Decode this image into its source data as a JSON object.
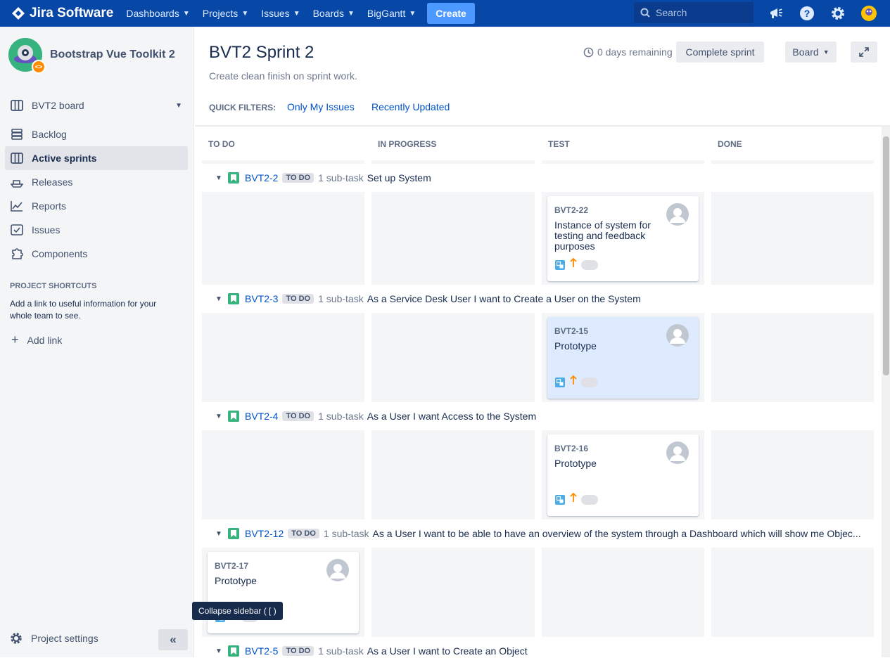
{
  "nav": {
    "logo": "Jira Software",
    "items": [
      "Dashboards",
      "Projects",
      "Issues",
      "Boards",
      "BigGantt"
    ],
    "create": "Create",
    "search_placeholder": "Search"
  },
  "sidebar": {
    "project_name": "Bootstrap Vue Toolkit 2",
    "board": "BVT2 board",
    "items": [
      "Backlog",
      "Active sprints",
      "Releases",
      "Reports",
      "Issues",
      "Components"
    ],
    "shortcuts_heading": "PROJECT SHORTCUTS",
    "shortcuts_text": "Add a link to useful information for your whole team to see.",
    "add_link": "Add link",
    "project_settings": "Project settings",
    "collapse_tooltip": "Collapse sidebar ( [ )"
  },
  "header": {
    "title": "BVT2 Sprint 2",
    "goal": "Create clean finish on sprint work.",
    "days_remaining": "0 days remaining",
    "complete_sprint": "Complete sprint",
    "board_menu": "Board",
    "quick_filters_label": "QUICK FILTERS:",
    "quick_filters": [
      "Only My Issues",
      "Recently Updated"
    ]
  },
  "columns": [
    "TO DO",
    "IN PROGRESS",
    "TEST",
    "DONE"
  ],
  "swimlanes": [
    {
      "key": "BVT2-2",
      "status": "TO DO",
      "subtasks": "1 sub-task",
      "summary": "Set up System",
      "card": {
        "column": 2,
        "key": "BVT2-22",
        "summary": "Instance of system for testing and feedback purposes"
      }
    },
    {
      "key": "BVT2-3",
      "status": "TO DO",
      "subtasks": "1 sub-task",
      "summary": "As a Service Desk User I want to Create a User on the System",
      "card": {
        "column": 2,
        "key": "BVT2-15",
        "summary": "Prototype"
      }
    },
    {
      "key": "BVT2-4",
      "status": "TO DO",
      "subtasks": "1 sub-task",
      "summary": "As a User I want Access to the System",
      "card": {
        "column": 2,
        "key": "BVT2-16",
        "summary": "Prototype"
      }
    },
    {
      "key": "BVT2-12",
      "status": "TO DO",
      "subtasks": "1 sub-task",
      "summary": "As a User I want to be able to have an overview of the system through a Dashboard which will show me Objec...",
      "card": {
        "column": 0,
        "key": "BVT2-17",
        "summary": "Prototype"
      }
    },
    {
      "key": "BVT2-5",
      "status": "TO DO",
      "subtasks": "1 sub-task",
      "summary": "As a User I want to Create an Object"
    }
  ],
  "colors": {
    "nav": "#0747a6",
    "accent": "#0052cc",
    "story": "#36b37e",
    "subtask": "#4bade8",
    "priority": "#ff8b00",
    "selected_card": "#deebff"
  }
}
